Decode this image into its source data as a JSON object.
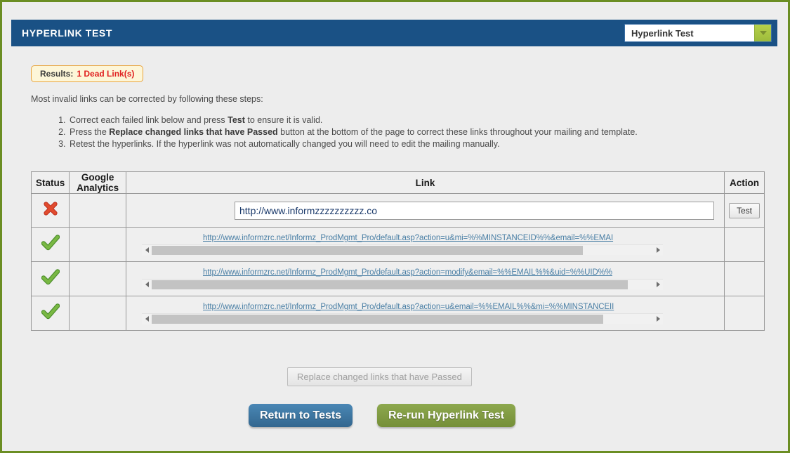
{
  "window": {
    "background_color": "#ededed",
    "border_color": "#6b8e23"
  },
  "header": {
    "title": "HYPERLINK TEST",
    "bar_color": "#1a5185",
    "test_selector": {
      "selected": "Hyperlink Test",
      "options": [
        "Hyperlink Test"
      ],
      "arrow_icon": "chevron-down-icon",
      "arrow_color": "#a9c543"
    }
  },
  "results": {
    "label": "Results:",
    "count_text": "1 Dead Link(s)",
    "count_color": "#e02020",
    "badge_bg": "#fdf6d8",
    "badge_border": "#e8a33d"
  },
  "instructions": {
    "intro": "Most invalid links can be corrected by following these steps:",
    "steps": [
      {
        "prefix": "Correct each failed link below and press ",
        "bold": "Test",
        "suffix": " to ensure it is valid."
      },
      {
        "prefix": "Press the ",
        "bold": "Replace changed links that have Passed",
        "suffix": " button at the bottom of the page to correct these links throughout your mailing and template."
      },
      {
        "prefix": "Retest the hyperlinks. If the hyperlink was not automatically changed you will need to edit the mailing manually.",
        "bold": "",
        "suffix": ""
      }
    ]
  },
  "table": {
    "columns": [
      "Status",
      "Google Analytics",
      "Link",
      "Action"
    ],
    "rows": [
      {
        "status": "failed",
        "status_icon": "red-x-icon",
        "google_analytics": "",
        "editable": true,
        "url_value": "http://www.informzzzzzzzzzz.co",
        "url_placeholder": "",
        "action_label": "Test",
        "scroll_thumb_percent": 0
      },
      {
        "status": "passed",
        "status_icon": "green-check-icon",
        "google_analytics": "",
        "editable": false,
        "url_value": "http://www.informzrc.net/Informz_ProdMgmt_Pro/default.asp?action=u&mi=%%MINSTANCEID%%&email=%%EMAI",
        "action_label": "",
        "scroll_thumb_percent": 86
      },
      {
        "status": "passed",
        "status_icon": "green-check-icon",
        "google_analytics": "",
        "editable": false,
        "url_value": "http://www.informzrc.net/Informz_ProdMgmt_Pro/default.asp?action=modify&email=%%EMAIL%%&uid=%%UID%%",
        "action_label": "",
        "scroll_thumb_percent": 95
      },
      {
        "status": "passed",
        "status_icon": "green-check-icon",
        "google_analytics": "",
        "editable": false,
        "url_value": "http://www.informzrc.net/Informz_ProdMgmt_Pro/default.asp?action=u&email=%%EMAIL%%&mi=%%MINSTANCEII",
        "action_label": "",
        "scroll_thumb_percent": 90
      }
    ]
  },
  "footer": {
    "replace_button": {
      "label": "Replace changed links that have Passed",
      "disabled": true
    },
    "return_button": {
      "label": "Return to Tests",
      "color": "#3b7093"
    },
    "rerun_button": {
      "label": "Re-run Hyperlink Test",
      "color": "#7f9940"
    }
  }
}
